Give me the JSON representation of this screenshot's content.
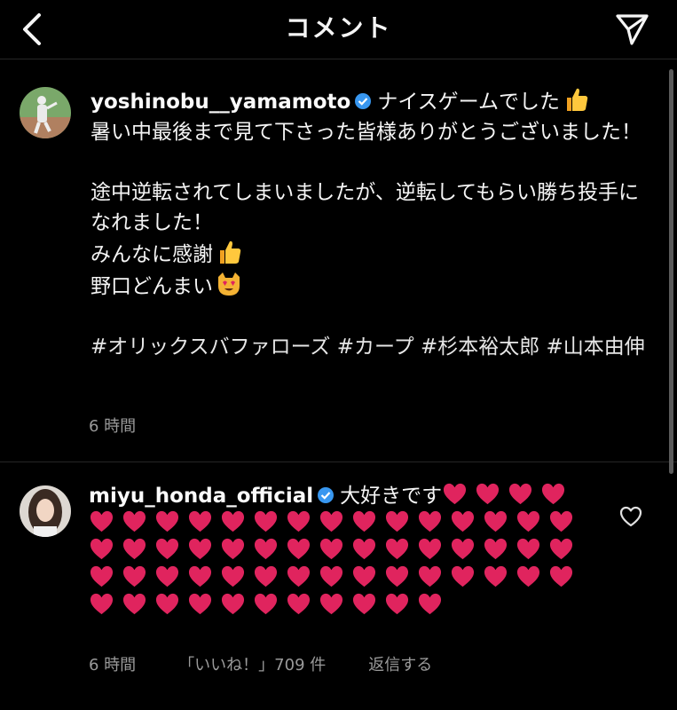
{
  "header": {
    "title": "コメント"
  },
  "post": {
    "username": "yoshinobu__yamamoto",
    "text_line1": "ナイスゲームでした",
    "text_line2": "暑い中最後まで見て下さった皆様ありがとうございました！",
    "text_line3": "途中逆転されてしまいましたが、逆転してもらい勝ち投手になれました！",
    "text_line4": "みんなに感謝",
    "text_line5": "野口どんまい",
    "hashtags": "#オリックスバファローズ #カープ #杉本裕太郎 #山本由伸",
    "time": "6 時間"
  },
  "comment": {
    "username": "miyu_honda_official",
    "text": "大好きです",
    "heart_count": 60,
    "time": "6 時間",
    "likes": "「いいね！」709 件",
    "reply_label": "返信する"
  },
  "colors": {
    "background": "#000000",
    "verified": "#3897f0",
    "heart": "#e0245e",
    "meta": "#9a9a9a"
  },
  "icons": {
    "back": "chevron-left-icon",
    "send": "paper-plane-icon",
    "like": "heart-outline-icon",
    "verified": "verified-badge-icon"
  }
}
